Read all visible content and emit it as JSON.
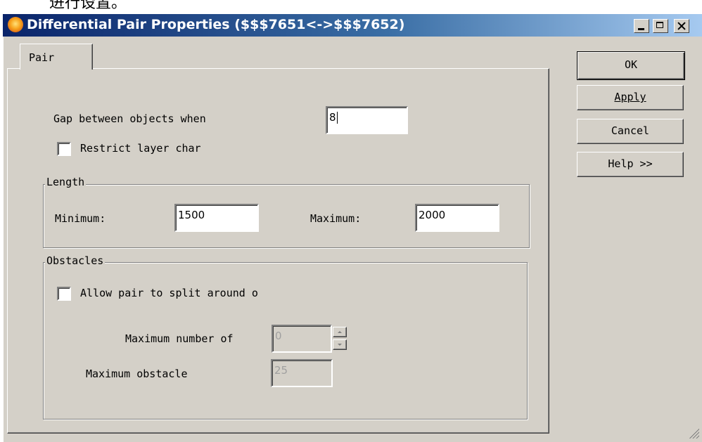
{
  "background_text": "进行设置。",
  "window": {
    "title": "Differential Pair Properties ($$$7651<->$$$7652)",
    "icon": "app-flame-icon"
  },
  "titlebar_buttons": {
    "minimize": "minimize-icon",
    "maximize": "maximize-icon",
    "close": "close-icon"
  },
  "tabs": [
    {
      "label": "Pair",
      "selected": true
    }
  ],
  "pair": {
    "gap_label": "Gap between objects when",
    "gap_value": "8",
    "restrict_label": "Restrict layer char",
    "restrict_checked": false
  },
  "length": {
    "title": "Length",
    "min_label": "Minimum:",
    "min_value": "1500",
    "max_label": "Maximum:",
    "max_value": "2000"
  },
  "obstacles": {
    "title": "Obstacles",
    "allow_label": "Allow pair to split around o",
    "allow_checked": false,
    "max_number_label": "Maximum number of",
    "max_number_value": "0",
    "max_obstacle_label": "Maximum obstacle",
    "max_obstacle_value": "25"
  },
  "buttons": {
    "ok": "OK",
    "apply": "Apply",
    "cancel": "Cancel",
    "help": "Help >>"
  }
}
